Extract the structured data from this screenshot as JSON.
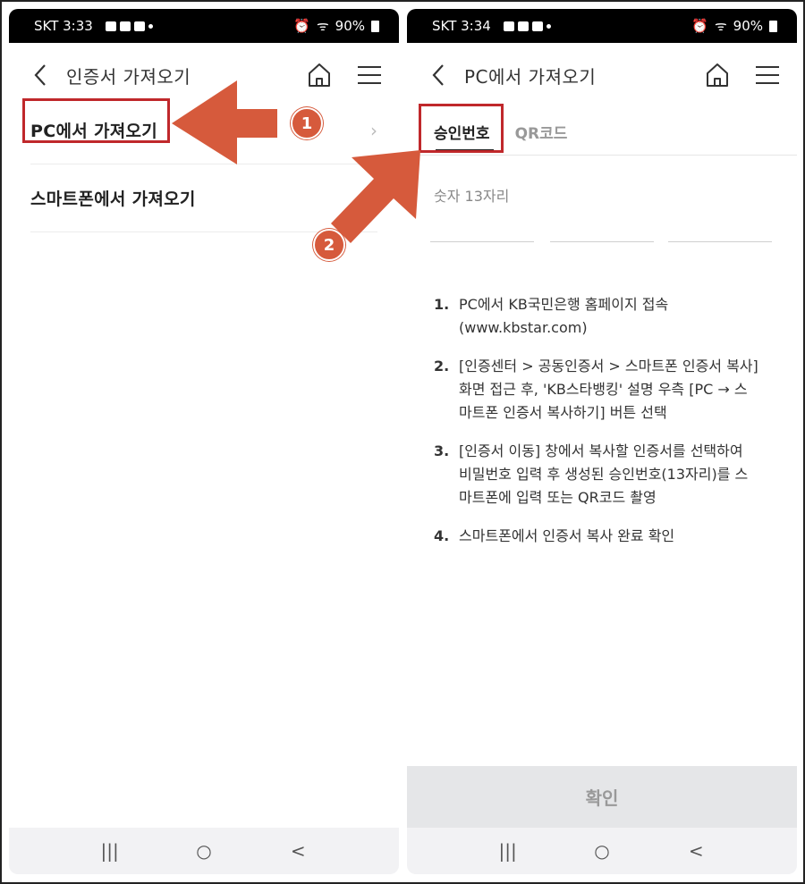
{
  "left_screen": {
    "status": {
      "time": "SKT 3:33",
      "battery": "90%"
    },
    "appbar": {
      "title": "인증서 가져오기"
    },
    "menu": [
      {
        "label": "PC에서 가져오기"
      },
      {
        "label": "스마트폰에서 가져오기"
      }
    ]
  },
  "right_screen": {
    "status": {
      "time": "SKT 3:34",
      "battery": "90%"
    },
    "appbar": {
      "title": "PC에서 가져오기"
    },
    "tabs": [
      {
        "label": "승인번호"
      },
      {
        "label": "QR코드"
      }
    ],
    "input_hint": "숫자 13자리",
    "steps": [
      {
        "no": "1.",
        "text": "PC에서 KB국민은행 홈페이지 접속",
        "text2": "(www.kbstar.com)"
      },
      {
        "no": "2.",
        "text": "[인증센터 > 공동인증서 > 스마트폰 인증서 복사]",
        "text2": "화면 접근 후, 'KB스타뱅킹' 설명 우측 [PC → 스",
        "text3": "마트폰 인증서 복사하기] 버튼 선택"
      },
      {
        "no": "3.",
        "text": "[인증서 이동] 창에서 복사할 인증서를 선택하여",
        "text2": "비밀번호 입력 후 생성된 승인번호(13자리)를 스",
        "text3": "마트폰에 입력 또는 QR코드 촬영"
      },
      {
        "no": "4.",
        "text": "스마트폰에서 인증서 복사 완료 확인"
      }
    ],
    "confirm_label": "확인"
  },
  "annotations": {
    "badge1": "1",
    "badge2": "2",
    "arrow_color": "#d65a3c",
    "box_color": "#c0282b"
  },
  "navbar": {
    "recents": "|||",
    "home": "○",
    "back": "<"
  }
}
